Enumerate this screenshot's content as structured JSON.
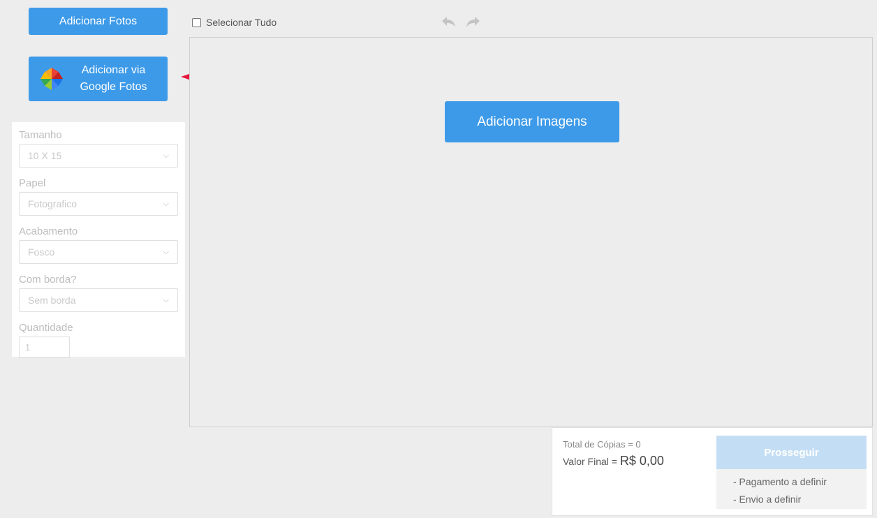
{
  "sidebar": {
    "add_photos_label": "Adicionar Fotos",
    "google_line1": "Adicionar via",
    "google_line2": "Google Fotos"
  },
  "options": {
    "size_label": "Tamanho",
    "size_value": "10 X 15",
    "paper_label": "Papel",
    "paper_value": "Fotografico",
    "finish_label": "Acabamento",
    "finish_value": "Fosco",
    "border_label": "Com borda?",
    "border_value": "Sem borda",
    "quantity_label": "Quantidade",
    "quantity_value": "1"
  },
  "toolbar": {
    "select_all_label": "Selecionar Tudo"
  },
  "main": {
    "add_images_label": "Adicionar Imagens"
  },
  "summary": {
    "total_copies": "Total de Cópias = 0",
    "final_value_label": "Valor Final = ",
    "final_value_amount": "R$ 0,00",
    "proceed_label": "Prosseguir",
    "payment_note": "- Pagamento a definir",
    "shipping_note": "- Envio a definir"
  },
  "colors": {
    "primary_blue": "#3d9ae8",
    "disabled_blue": "#c3def4",
    "arrow_red": "#e8173c"
  }
}
